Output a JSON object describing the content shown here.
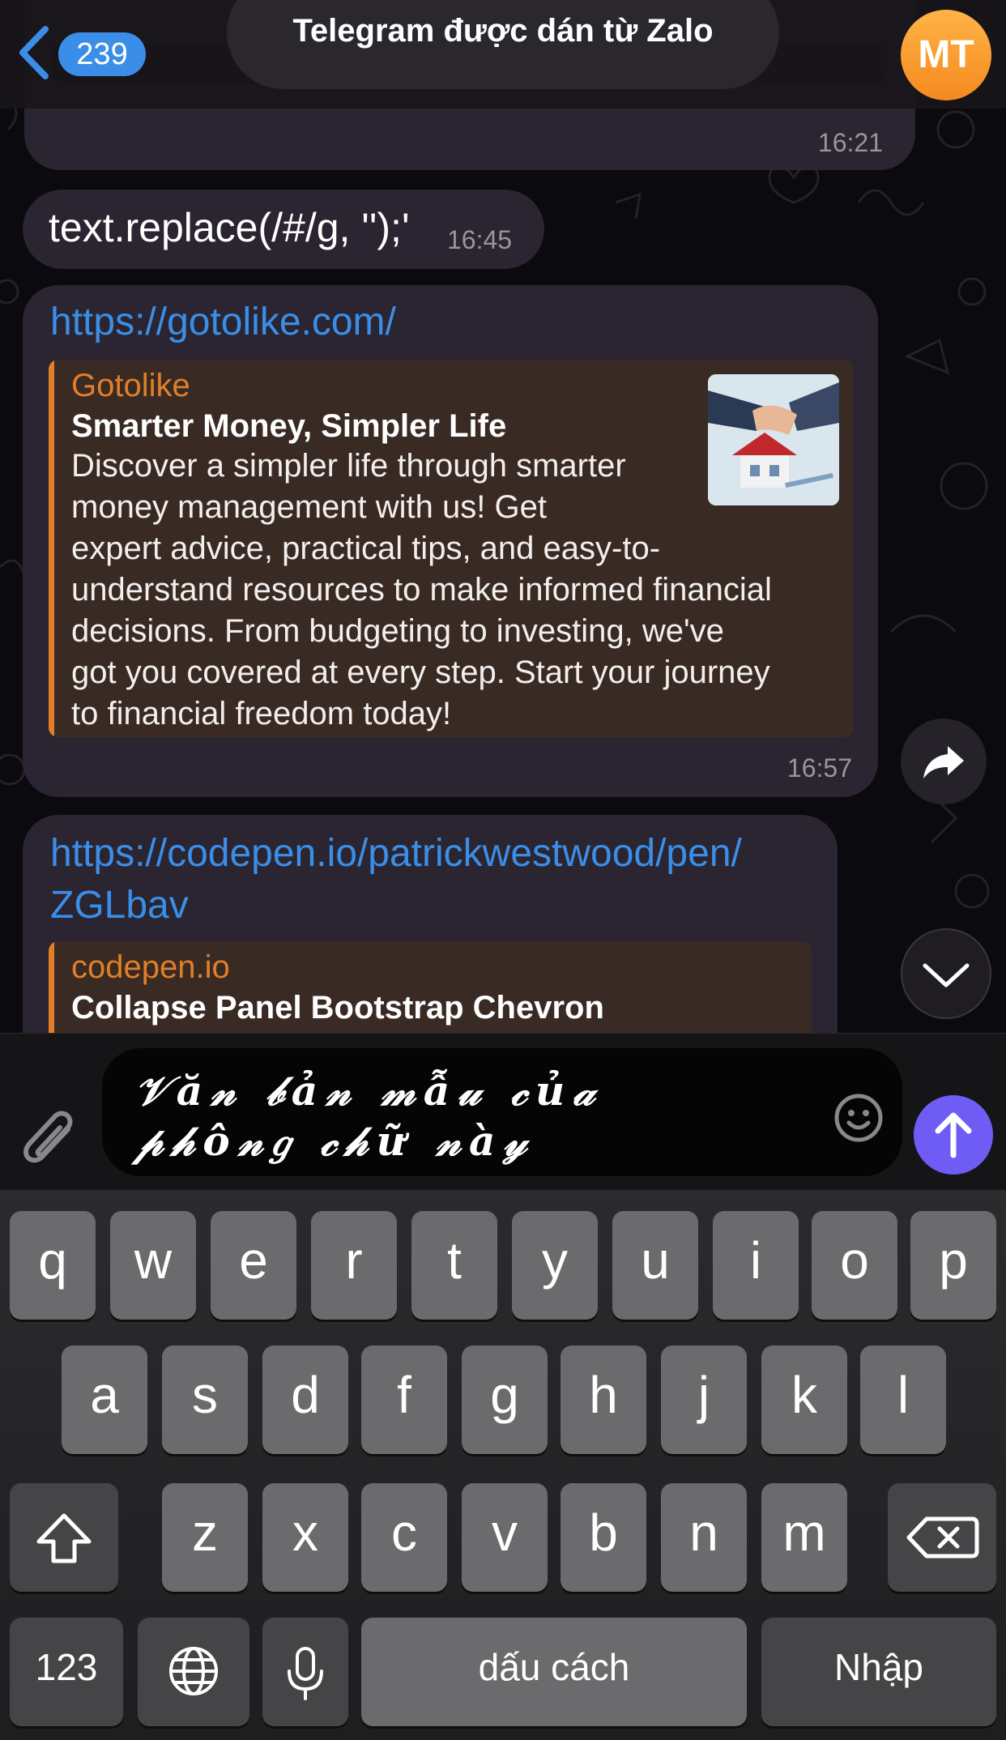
{
  "header": {
    "unread_count": "239",
    "chat_title": "Telegram được dán từ Zalo",
    "avatar_initials": "MT"
  },
  "messages": {
    "prev_time": "16:21",
    "text_message": "text.replace(/#/g, '');'",
    "text_time": "16:45",
    "link1": {
      "url": "https://gotolike.com/",
      "site": "Gotolike",
      "title": "Smarter Money, Simpler Life",
      "description_lines": [
        "Discover a simpler life through smarter",
        "money management with us! Get",
        "expert advice, practical tips, and easy-to-",
        "understand resources to make informed financial",
        "decisions. From budgeting to investing, we've",
        "got you covered at every step. Start your journey",
        "to financial freedom today!"
      ],
      "time": "16:57"
    },
    "link2": {
      "url_line1": "https://codepen.io/patrickwestwood/pen/",
      "url_line2": "ZGLbav",
      "site": "codepen.io",
      "title": "Collapse Panel Bootstrap Chevron"
    }
  },
  "composer": {
    "text_line1": "𝒱ă𝓃 𝒷ả𝓃 𝓂ẫ𝓊 𝒸ủ𝒶",
    "text_line2": "𝓅𝒽ô𝓃𝑔 𝒸𝒽ữ 𝓃à𝓎"
  },
  "keyboard": {
    "row1": [
      "q",
      "w",
      "e",
      "r",
      "t",
      "y",
      "u",
      "i",
      "o",
      "p"
    ],
    "row2": [
      "a",
      "s",
      "d",
      "f",
      "g",
      "h",
      "j",
      "k",
      "l"
    ],
    "row3": [
      "z",
      "x",
      "c",
      "v",
      "b",
      "n",
      "m"
    ],
    "numbers_key": "123",
    "space_key": "dấu cách",
    "return_key": "Nhập"
  },
  "colors": {
    "accent_blue": "#3b8ee8",
    "preview_orange": "#e07f28",
    "send_purple": "#6e5cf5",
    "avatar_orange": "#f58a1f"
  },
  "icons": [
    "back-chevron-icon",
    "forward-icon",
    "chevron-down-icon",
    "paperclip-icon",
    "emoji-icon",
    "send-arrow-icon",
    "shift-icon",
    "globe-icon",
    "microphone-icon",
    "backspace-icon"
  ]
}
